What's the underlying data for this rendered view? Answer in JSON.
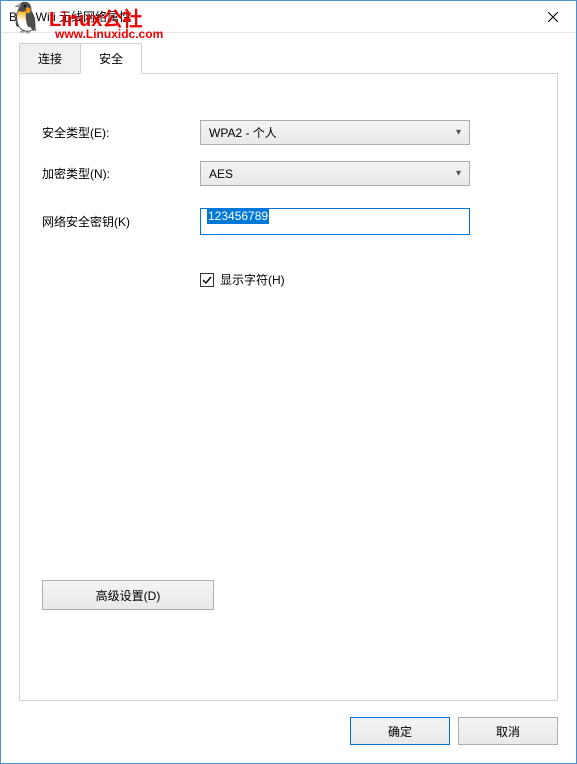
{
  "window": {
    "title": "B_X-Wifi 无线网络属性"
  },
  "watermark": {
    "line1": "Linux公社",
    "line2": "www.Linuxidc.com"
  },
  "tabs": {
    "connect": "连接",
    "security": "安全"
  },
  "fields": {
    "security_type_label": "安全类型(E):",
    "security_type_value": "WPA2 - 个人",
    "encryption_type_label": "加密类型(N):",
    "encryption_type_value": "AES",
    "network_key_label": "网络安全密钥(K)",
    "network_key_value": "123456789",
    "show_chars_label": "显示字符(H)",
    "show_chars_checked": true
  },
  "buttons": {
    "advanced": "高级设置(D)",
    "ok": "确定",
    "cancel": "取消"
  }
}
